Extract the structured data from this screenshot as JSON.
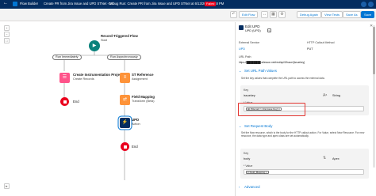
{
  "header": {
    "app_title": "Flow Builder",
    "flow_title": "Create PR from Jira Issue and UPD STNet - V1",
    "debug_title": "Debug Run: Create PR from Jira Issue and UPD STNet at 6/13/2024, 8:48 PM",
    "failed_badge": "Failed"
  },
  "toolbar": {
    "edit_flow": "Edit Flow",
    "debug_again": "Debug Again",
    "view_tests": "View Tests",
    "save_as": "Save As",
    "save": "Save"
  },
  "canvas": {
    "start": {
      "title": "Record-Triggered Flow",
      "subtitle": "Start"
    },
    "branch_left": "Run Immediately",
    "branch_right": "Run Asynchronously",
    "left_node": {
      "title": "Create Instrumentation Project",
      "subtitle": "Create Records"
    },
    "left_end": "End",
    "right_nodes": [
      {
        "title": "ST Reference",
        "subtitle": "Assignment"
      },
      {
        "title": "Field Mapping",
        "subtitle": "Transform (Beta)"
      },
      {
        "title": "UPD",
        "subtitle": "Action"
      }
    ],
    "right_end": "End"
  },
  "panel": {
    "title": "Edit UPD",
    "subtitle": "UPD (UPD)",
    "external_service_label": "External Service",
    "external_service_value": "UPD",
    "http_method_label": "HTTP Callout Method",
    "http_method_value": "PUT",
    "url_path_label": "URL Path",
    "url_path_value": "https://████████.stlesson.net/rest/api/2/issue/{issuekey}",
    "url_params": {
      "heading": "Set URL Path Values",
      "description": "Set the key values that complete the URL path to access the external data.",
      "key_label": "Key",
      "key_value": "issuekey",
      "type_value": "String",
      "value_label": "* Value",
      "value_chip": "{!Record > Jira Issue Key}"
    },
    "request_body": {
      "heading": "Set Request Body",
      "description": "Set the flow resource, which is the body for the HTTP callout action. For Value, select New Resource. For new resource, the data type and apex class are set automatically.",
      "key_label": "Key",
      "key_value": "body",
      "type_value": "Apex",
      "value_label": "* Value",
      "value_chip": "Field_Mapping"
    },
    "advanced": "Advanced"
  }
}
